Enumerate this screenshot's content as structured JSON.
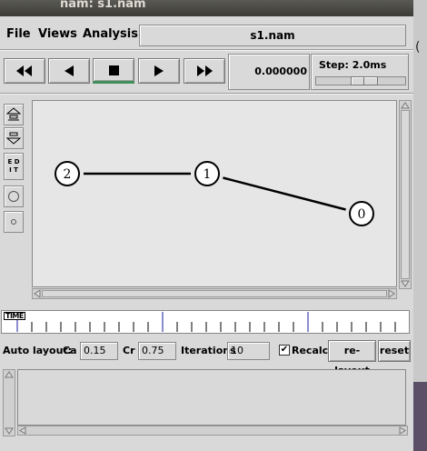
{
  "window": {
    "title": "nam: s1.nam"
  },
  "menu": {
    "items": [
      {
        "label": "File"
      },
      {
        "label": "Views"
      },
      {
        "label": "Analysis"
      }
    ],
    "filename": "s1.nam"
  },
  "controls": {
    "buttons": [
      "rewind",
      "play-backward",
      "stop",
      "play-forward",
      "fast-forward"
    ],
    "time": "0.000000",
    "step_label": "Step: 2.0ms"
  },
  "tools": {
    "edit_label_line1": "E D",
    "edit_label_line2": "I T"
  },
  "network": {
    "nodes": [
      {
        "id": "2",
        "label": "2"
      },
      {
        "id": "1",
        "label": "1"
      },
      {
        "id": "0",
        "label": "0"
      }
    ],
    "links": [
      {
        "from": "2",
        "to": "1"
      },
      {
        "from": "1",
        "to": "0"
      }
    ]
  },
  "timeline": {
    "label": "TIME"
  },
  "auto_layout": {
    "label": "Auto layout:",
    "ca_label": "Ca",
    "ca_value": "0.15",
    "cr_label": "Cr",
    "cr_value": "0.75",
    "iterations_label": "Iterations",
    "iterations_value": "10",
    "recalc_label": "Recalc",
    "recalc_checked": true,
    "relayout_label": "re-layout",
    "reset_label": "reset"
  },
  "desktop": {
    "edge_glyph": "("
  }
}
